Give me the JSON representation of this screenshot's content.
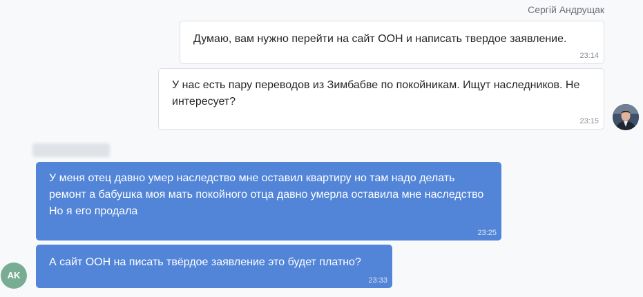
{
  "chat": {
    "outgoing_sender_name": "Сергій Андрущак",
    "incoming_sender_initials": "AK",
    "messages": [
      {
        "text": "Думаю, вам нужно перейти на сайт ООН и написать твердое заявление.",
        "time": "23:14"
      },
      {
        "text": "У нас есть пару переводов из Зимбабве по покойникам. Ищут наследников. Не интересует?",
        "time": "23:15"
      },
      {
        "text": "У меня отец давно умер наследство мне оставил квартиру но там надо делать ремонт а бабушка моя мать покойного отца давно умерла оставила мне наследство Но я его продала",
        "time": "23:25"
      },
      {
        "text": "А сайт ООН на писать твёрдое  заявление это будет платно?",
        "time": "23:33"
      }
    ]
  },
  "icons": {
    "outgoing_avatar": "user-photo-avatar",
    "incoming_avatar": "initials-avatar",
    "redacted_name": "blurred-sender-name"
  },
  "colors": {
    "incoming_bubble": "#5284d8",
    "outgoing_bubble": "#ffffff",
    "initials_avatar": "#79ad93",
    "background": "#f8f9fb"
  }
}
